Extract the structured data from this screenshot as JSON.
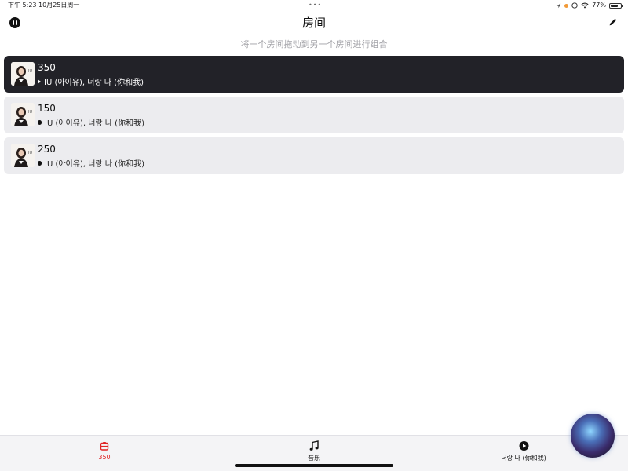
{
  "status_bar": {
    "time_date": "下午 5:23   10月25日周一",
    "dots": "•••",
    "battery_text": "77%",
    "battery_level": 0.77
  },
  "header": {
    "title": "房间",
    "hint": "将一个房间拖动到另一个房间进行组合"
  },
  "rooms": [
    {
      "name": "350",
      "subtitle": "IU (아이유), 너랑 나 (你和我)",
      "state": "playing"
    },
    {
      "name": "150",
      "subtitle": "IU (아이유), 너랑 나 (你和我)",
      "state": "stopped"
    },
    {
      "name": "250",
      "subtitle": "IU (아이유), 너랑 나 (你和我)",
      "state": "stopped"
    }
  ],
  "tabs": [
    {
      "label": "350",
      "icon": "room-icon",
      "active": true
    },
    {
      "label": "音乐",
      "icon": "music-note-icon",
      "active": false
    },
    {
      "label": "너랑 나 (你和我)",
      "icon": "play-circle-icon",
      "active": false
    }
  ],
  "colors": {
    "accent": "#e02424",
    "active_row": "#222228",
    "row": "#ececef"
  }
}
